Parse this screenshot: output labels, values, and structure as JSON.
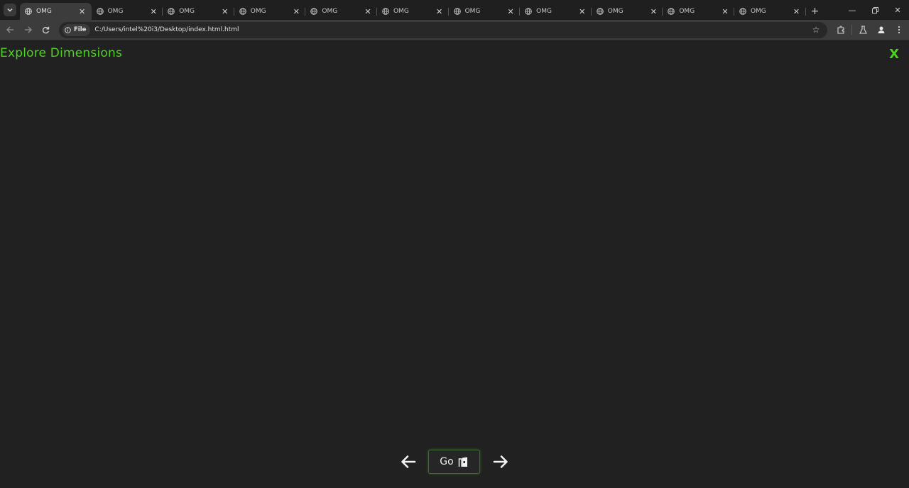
{
  "browser": {
    "tabs": [
      {
        "title": "OMG",
        "active": true
      },
      {
        "title": "OMG",
        "active": false
      },
      {
        "title": "OMG",
        "active": false
      },
      {
        "title": "OMG",
        "active": false
      },
      {
        "title": "OMG",
        "active": false
      },
      {
        "title": "OMG",
        "active": false
      },
      {
        "title": "OMG",
        "active": false
      },
      {
        "title": "OMG",
        "active": false
      },
      {
        "title": "OMG",
        "active": false
      },
      {
        "title": "OMG",
        "active": false
      },
      {
        "title": "OMG",
        "active": false
      }
    ],
    "address": {
      "chip_label": "File",
      "url": "C:/Users/intel%20i3/Desktop/index.html.html"
    }
  },
  "page": {
    "title": "Explore Dimensions",
    "close_label": "X",
    "go_label": "Go",
    "accent_color": "#4cd41f",
    "background_color": "#212121"
  }
}
